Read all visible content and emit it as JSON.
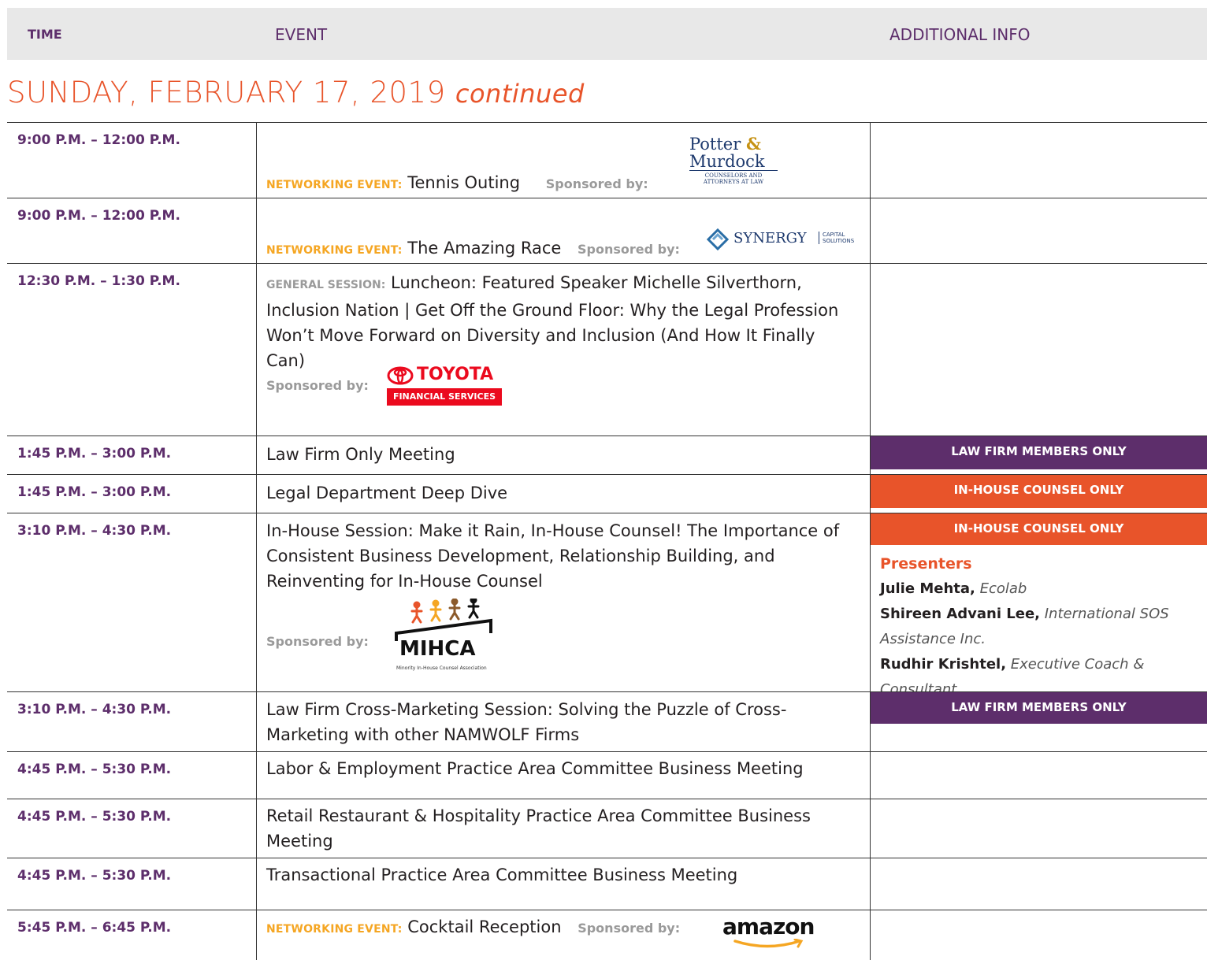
{
  "header": {
    "time": "TIME",
    "event": "EVENT",
    "info": "ADDITIONAL INFO"
  },
  "day": {
    "title": "SUNDAY, FEBRUARY 17, 2019",
    "continued": "continued"
  },
  "rows": [
    {
      "time": "9:00 P.M. – 12:00 P.M.",
      "label": "NETWORKING EVENT:",
      "title": "Tennis Outing",
      "sponsored": "Sponsored by:",
      "sponsor": "Potter & Murdock"
    },
    {
      "time": "9:00 P.M. – 12:00 P.M.",
      "label": "NETWORKING EVENT:",
      "title": "The Amazing Race",
      "sponsored": "Sponsored by:",
      "sponsor": "SYNERGY"
    },
    {
      "time": "12:30 P.M. – 1:30 P.M.",
      "label": "GENERAL SESSION:",
      "title": "Luncheon: Featured Speaker Michelle Silverthorn, Inclusion Nation | Get Off the Ground Floor: Why the Legal Profession Won’t Move Forward on Diversity and Inclusion (And How It Finally Can)",
      "sponsored": "Sponsored by:",
      "sponsor": "TOYOTA"
    },
    {
      "time": "1:45 P.M. – 3:00 P.M.",
      "title": "Law Firm Only Meeting",
      "badge": "LAW FIRM MEMBERS ONLY"
    },
    {
      "time": "1:45 P.M. – 3:00 P.M.",
      "title": "Legal Department Deep Dive",
      "badge": "IN-HOUSE COUNSEL ONLY"
    },
    {
      "time": "3:10 P.M. – 4:30 P.M.",
      "title": "In-House Session: Make it Rain, In-House Counsel! The Importance of Consistent Business Development, Relationship Building, and Reinventing for In-House Counsel",
      "sponsored": "Sponsored by:",
      "sponsor": "MIHCA",
      "badge": "IN-HOUSE COUNSEL ONLY",
      "presenters_heading": "Presenters",
      "presenters": [
        {
          "name": "Julie Mehta,",
          "org": "Ecolab"
        },
        {
          "name": "Shireen Advani Lee,",
          "org": "International SOS Assistance Inc."
        },
        {
          "name": "Rudhir Krishtel,",
          "org": "Executive Coach & Consultant"
        }
      ]
    },
    {
      "time": "3:10 P.M. – 4:30 P.M.",
      "title": "Law Firm Cross-Marketing Session: Solving the Puzzle of Cross-Marketing with other NAMWOLF Firms",
      "badge": "LAW FIRM MEMBERS ONLY"
    },
    {
      "time": "4:45 P.M. – 5:30 P.M.",
      "title": "Labor & Employment Practice Area Committee Business Meeting"
    },
    {
      "time": "4:45 P.M. – 5:30 P.M.",
      "title": "Retail Restaurant & Hospitality Practice Area Committee Business Meeting"
    },
    {
      "time": "4:45 P.M. – 5:30 P.M.",
      "title": "Transactional Practice Area Committee Business Meeting"
    },
    {
      "time": "5:45 P.M. – 6:45 P.M.",
      "label": "NETWORKING EVENT:",
      "title": "Cocktail Reception",
      "sponsored": "Sponsored by:",
      "sponsor": "amazon"
    }
  ],
  "logos": {
    "potter_line1": "Potter",
    "potter_line2": "Murdock",
    "potter_sub1": "COUNSELORS AND",
    "potter_sub2": "ATTORNEYS AT LAW",
    "synergy": "SYNERGY",
    "synergy_sub1": "CAPITAL",
    "synergy_sub2": "SOLUTIONS",
    "toyota": "TOYOTA",
    "toyota_sub": "FINANCIAL SERVICES",
    "mihca": "MIHCA",
    "mihca_sub": "Minority In-House Counsel Association",
    "amazon": "amazon"
  },
  "colors": {
    "purple": "#5d2e6b",
    "orange": "#e8542a",
    "gold": "#f5a623"
  }
}
